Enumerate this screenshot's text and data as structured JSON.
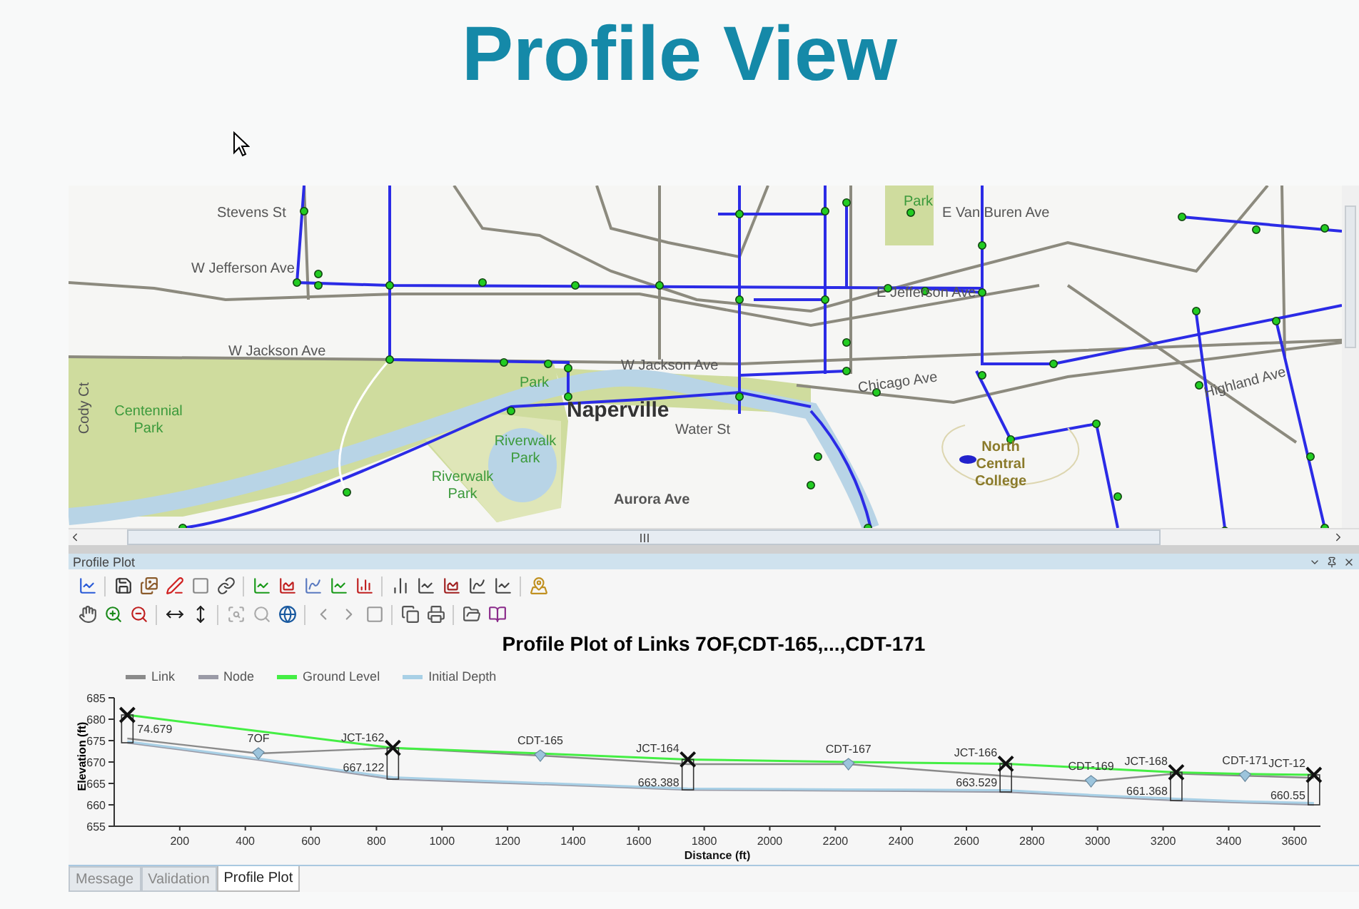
{
  "page_title": "Profile View",
  "map": {
    "labels": [
      {
        "text": "Park",
        "kind": "park"
      },
      {
        "text": "Stevens St",
        "kind": "street"
      },
      {
        "text": "E Van Buren Ave",
        "kind": "street"
      },
      {
        "text": "W Jefferson Ave",
        "kind": "street"
      },
      {
        "text": "E Jefferson Ave",
        "kind": "street"
      },
      {
        "text": "W Jackson Ave",
        "kind": "street"
      },
      {
        "text": "W Jackson Ave",
        "kind": "street"
      },
      {
        "text": "Park",
        "kind": "park"
      },
      {
        "text": "Chicago Ave",
        "kind": "street"
      },
      {
        "text": "Highland Ave",
        "kind": "street"
      },
      {
        "text": "Cody Ct",
        "kind": "street"
      },
      {
        "text": "Centennial Park",
        "kind": "park"
      },
      {
        "text": "Naperville",
        "kind": "town"
      },
      {
        "text": "Water St",
        "kind": "street"
      },
      {
        "text": "Riverwalk Park",
        "kind": "park"
      },
      {
        "text": "North Central College",
        "kind": "college"
      },
      {
        "text": "Riverwalk Park",
        "kind": "park"
      },
      {
        "text": "Aurora Ave",
        "kind": "place"
      }
    ]
  },
  "panel": {
    "title": "Profile Plot",
    "chart_data": {
      "type": "line",
      "title": "Profile Plot of Links 7OF,CDT-165,...,CDT-171",
      "xlabel": "Distance (ft)",
      "ylabel": "Elevation (ft)",
      "x": [
        40,
        440,
        850,
        1300,
        1750,
        2240,
        2720,
        2980,
        3240,
        3450,
        3660
      ],
      "series": [
        {
          "name": "Link",
          "color": "#8a8a8a",
          "values": [
            675.5,
            672,
            673.3,
            671.5,
            669.5,
            669.5,
            666.7,
            665.5,
            667.3,
            666.8,
            666.3
          ]
        },
        {
          "name": "Node",
          "color": "#9a9aa6",
          "values": [
            674.5,
            670.5,
            666,
            664.8,
            663.5,
            663.3,
            663,
            662,
            661,
            660.5,
            660
          ]
        },
        {
          "name": "Ground Level",
          "color": "#44ee44",
          "values": [
            681,
            677.2,
            673.3,
            672,
            670.6,
            670,
            669.6,
            668.6,
            667.6,
            667.2,
            667
          ]
        },
        {
          "name": "Initial Depth",
          "color": "#a8d0e6",
          "values": [
            674.8,
            670.8,
            666.4,
            665.1,
            663.8,
            663.6,
            663.4,
            662.3,
            661.4,
            660.8,
            660.4
          ]
        }
      ],
      "xlim": [
        0,
        3680
      ],
      "ylim": [
        655,
        685
      ],
      "xticks": [
        200,
        400,
        600,
        800,
        1000,
        1200,
        1400,
        1600,
        1800,
        2000,
        2200,
        2400,
        2600,
        2800,
        3000,
        3200,
        3400,
        3600
      ],
      "yticks": [
        655,
        660,
        665,
        670,
        675,
        680,
        685
      ],
      "annotations": [
        {
          "x": 40,
          "y": 676.5,
          "text": "74.679"
        },
        {
          "x": 440,
          "y": 674.3,
          "text": "7OF"
        },
        {
          "x": 850,
          "y": 674.5,
          "text": "JCT-162"
        },
        {
          "x": 850,
          "y": 667.5,
          "text": "667.122"
        },
        {
          "x": 1300,
          "y": 673.8,
          "text": "CDT-165"
        },
        {
          "x": 1750,
          "y": 672,
          "text": "JCT-164"
        },
        {
          "x": 1750,
          "y": 664,
          "text": "663.388"
        },
        {
          "x": 2240,
          "y": 671.8,
          "text": "CDT-167"
        },
        {
          "x": 2720,
          "y": 671,
          "text": "JCT-166"
        },
        {
          "x": 2720,
          "y": 664,
          "text": "663.529"
        },
        {
          "x": 2980,
          "y": 667.8,
          "text": "CDT-169"
        },
        {
          "x": 3240,
          "y": 669,
          "text": "JCT-168"
        },
        {
          "x": 3240,
          "y": 662,
          "text": "661.368"
        },
        {
          "x": 3450,
          "y": 669.1,
          "text": "CDT-171"
        },
        {
          "x": 3660,
          "y": 668.5,
          "text": "JCT-12"
        },
        {
          "x": 3660,
          "y": 661,
          "text": "660.55"
        }
      ],
      "legend": "top"
    }
  },
  "tabs": [
    {
      "label": "Message",
      "selected": false
    },
    {
      "label": "Validation",
      "selected": false
    },
    {
      "label": "Profile Plot",
      "selected": true
    }
  ]
}
